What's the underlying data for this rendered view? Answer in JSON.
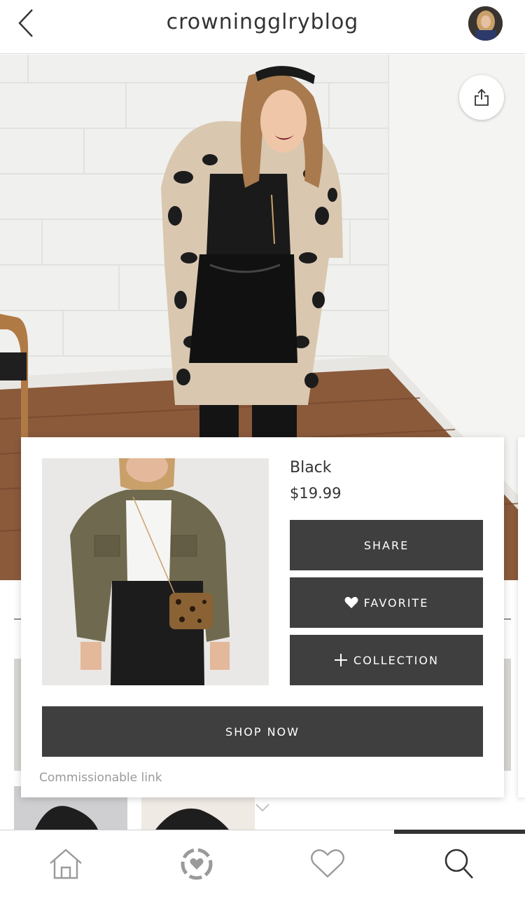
{
  "header": {
    "title": "crowningglryblog"
  },
  "product": {
    "name": "Black",
    "price": "$19.99",
    "share_label": "SHARE",
    "favorite_label": "FAVORITE",
    "collection_label": "COLLECTION",
    "shop_label": "SHOP NOW",
    "commission_note": "Commissionable link"
  },
  "icons": {
    "back": "chevron-left-icon",
    "share": "share-icon",
    "heart": "heart-icon",
    "plus": "plus-icon",
    "home": "home-icon",
    "discover": "discover-icon",
    "favorites": "heart-outline-icon",
    "search": "search-icon"
  },
  "colors": {
    "button_bg": "#3f3f3f",
    "button_text": "#ffffff",
    "active_nav": "#333333",
    "muted_text": "#9a9a9a"
  },
  "bottom_nav": {
    "active_tab": "search"
  }
}
